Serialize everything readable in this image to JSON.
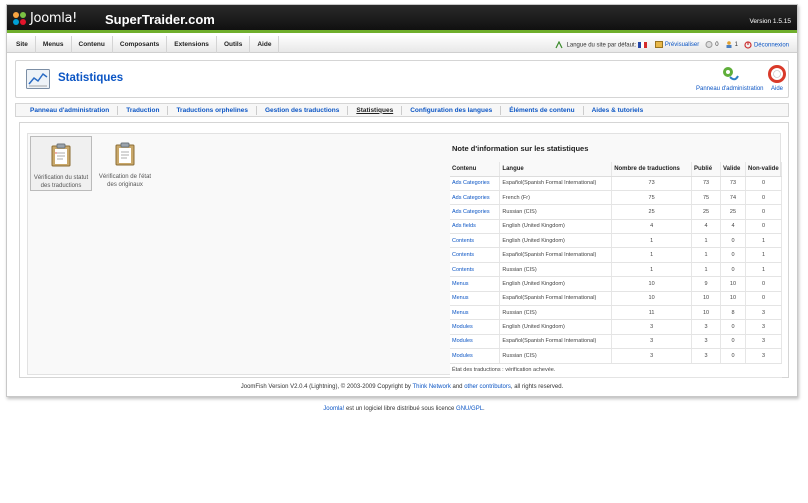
{
  "topbar": {
    "logo_text": "Joomla!",
    "site_name": "SuperTraider.com",
    "version": "Version 1.5.15"
  },
  "menu": {
    "items": [
      {
        "label": "Site"
      },
      {
        "label": "Menus"
      },
      {
        "label": "Contenu"
      },
      {
        "label": "Composants"
      },
      {
        "label": "Extensions"
      },
      {
        "label": "Outils"
      },
      {
        "label": "Aide"
      }
    ]
  },
  "status": {
    "language_label": "Langue du site par défaut:",
    "preview": "Prévisualiser",
    "messages": "0",
    "users": "1",
    "logout": "Déconnexion"
  },
  "header": {
    "title": "Statistiques",
    "cpanel_label": "Panneau d'administration",
    "help_label": "Aide"
  },
  "subnav": {
    "items": [
      {
        "label": "Panneau d'administration"
      },
      {
        "label": "Traduction"
      },
      {
        "label": "Traductions orphelines"
      },
      {
        "label": "Gestion des traductions"
      },
      {
        "label": "Statistiques"
      },
      {
        "label": "Configuration des langues"
      },
      {
        "label": "Éléments de contenu"
      },
      {
        "label": "Aides & tutoriels"
      }
    ]
  },
  "panels": [
    {
      "line1": "Vérification du statut",
      "line2": "des traductions"
    },
    {
      "line1": "Vérification de l'état",
      "line2": "des originaux"
    }
  ],
  "stats": {
    "title": "Note d'information sur les statistiques",
    "headers": [
      "Contenu",
      "Langue",
      "Nombre de traductions",
      "Publié",
      "Valide",
      "Non-valide"
    ],
    "rows": [
      [
        "Ads Categories",
        "Español(Spanish Formal International)",
        "73",
        "73",
        "73",
        "0"
      ],
      [
        "Ads Categories",
        "French (Fr)",
        "75",
        "75",
        "74",
        "0"
      ],
      [
        "Ads Categories",
        "Russian (CIS)",
        "25",
        "25",
        "25",
        "0"
      ],
      [
        "Ads fields",
        "English (United Kingdom)",
        "4",
        "4",
        "4",
        "0"
      ],
      [
        "Contents",
        "English (United Kingdom)",
        "1",
        "1",
        "0",
        "1"
      ],
      [
        "Contents",
        "Español(Spanish Formal International)",
        "1",
        "1",
        "0",
        "1"
      ],
      [
        "Contents",
        "Russian (CIS)",
        "1",
        "1",
        "0",
        "1"
      ],
      [
        "Menus",
        "English (United Kingdom)",
        "10",
        "9",
        "10",
        "0"
      ],
      [
        "Menus",
        "Español(Spanish Formal International)",
        "10",
        "10",
        "10",
        "0"
      ],
      [
        "Menus",
        "Russian (CIS)",
        "11",
        "10",
        "8",
        "3"
      ],
      [
        "Modules",
        "English (United Kingdom)",
        "3",
        "3",
        "0",
        "3"
      ],
      [
        "Modules",
        "Español(Spanish Formal International)",
        "3",
        "3",
        "0",
        "3"
      ],
      [
        "Modules",
        "Russian (CIS)",
        "3",
        "3",
        "0",
        "3"
      ]
    ],
    "footer": "État des traductions : vérification achevée."
  },
  "copyright": {
    "prefix": "JoomFish Version V2.0.4 (Lightning), © 2003-2009 Copyright by",
    "link1": "Think Network",
    "and": "and",
    "link2": "other contributors",
    "suffix": ", all rights reserved."
  },
  "license": {
    "link1": "Joomla!",
    "middle": "est un logiciel libre distribué sous licence",
    "link2": "GNU/GPL",
    "end": "."
  },
  "colors": {
    "accent_green": "#6fae2c",
    "link_blue": "#0b55c4",
    "topbar": "#1a1a1a"
  },
  "icons": [
    "joomla-logo-icon",
    "language-icon",
    "preview-icon",
    "messages-icon",
    "users-icon",
    "logout-icon",
    "stats-chart-icon",
    "cpanel-icon",
    "help-icon",
    "clipboard-icon"
  ]
}
